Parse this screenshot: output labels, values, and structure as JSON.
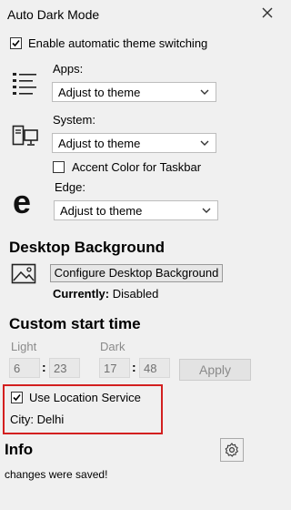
{
  "window": {
    "title": "Auto Dark Mode"
  },
  "enable_switch": {
    "label": "Enable automatic theme switching",
    "checked": true
  },
  "apps": {
    "label": "Apps:",
    "value": "Adjust to theme",
    "icon": "list-icon"
  },
  "system": {
    "label": "System:",
    "value": "Adjust to theme",
    "icon": "computer-icon"
  },
  "accent_taskbar": {
    "label": "Accent Color for Taskbar",
    "checked": false
  },
  "edge": {
    "label": "Edge:",
    "value": "Adjust to theme",
    "icon": "edge-icon"
  },
  "desktop_bg": {
    "heading": "Desktop Background",
    "button": "Configure Desktop Background",
    "currently_label": "Currently:",
    "currently_value": "Disabled"
  },
  "custom_time": {
    "heading": "Custom start time",
    "light_label": "Light",
    "dark_label": "Dark",
    "light_hour": "6",
    "light_minute": "23",
    "dark_hour": "17",
    "dark_minute": "48",
    "separator": ":",
    "apply": "Apply"
  },
  "location": {
    "label": "Use Location Service",
    "checked": true,
    "city": "City: Delhi"
  },
  "info": {
    "heading": "Info",
    "status": "changes were saved!"
  },
  "colors": {
    "highlight_border": "#d32020",
    "background": "#f0f0f0"
  }
}
